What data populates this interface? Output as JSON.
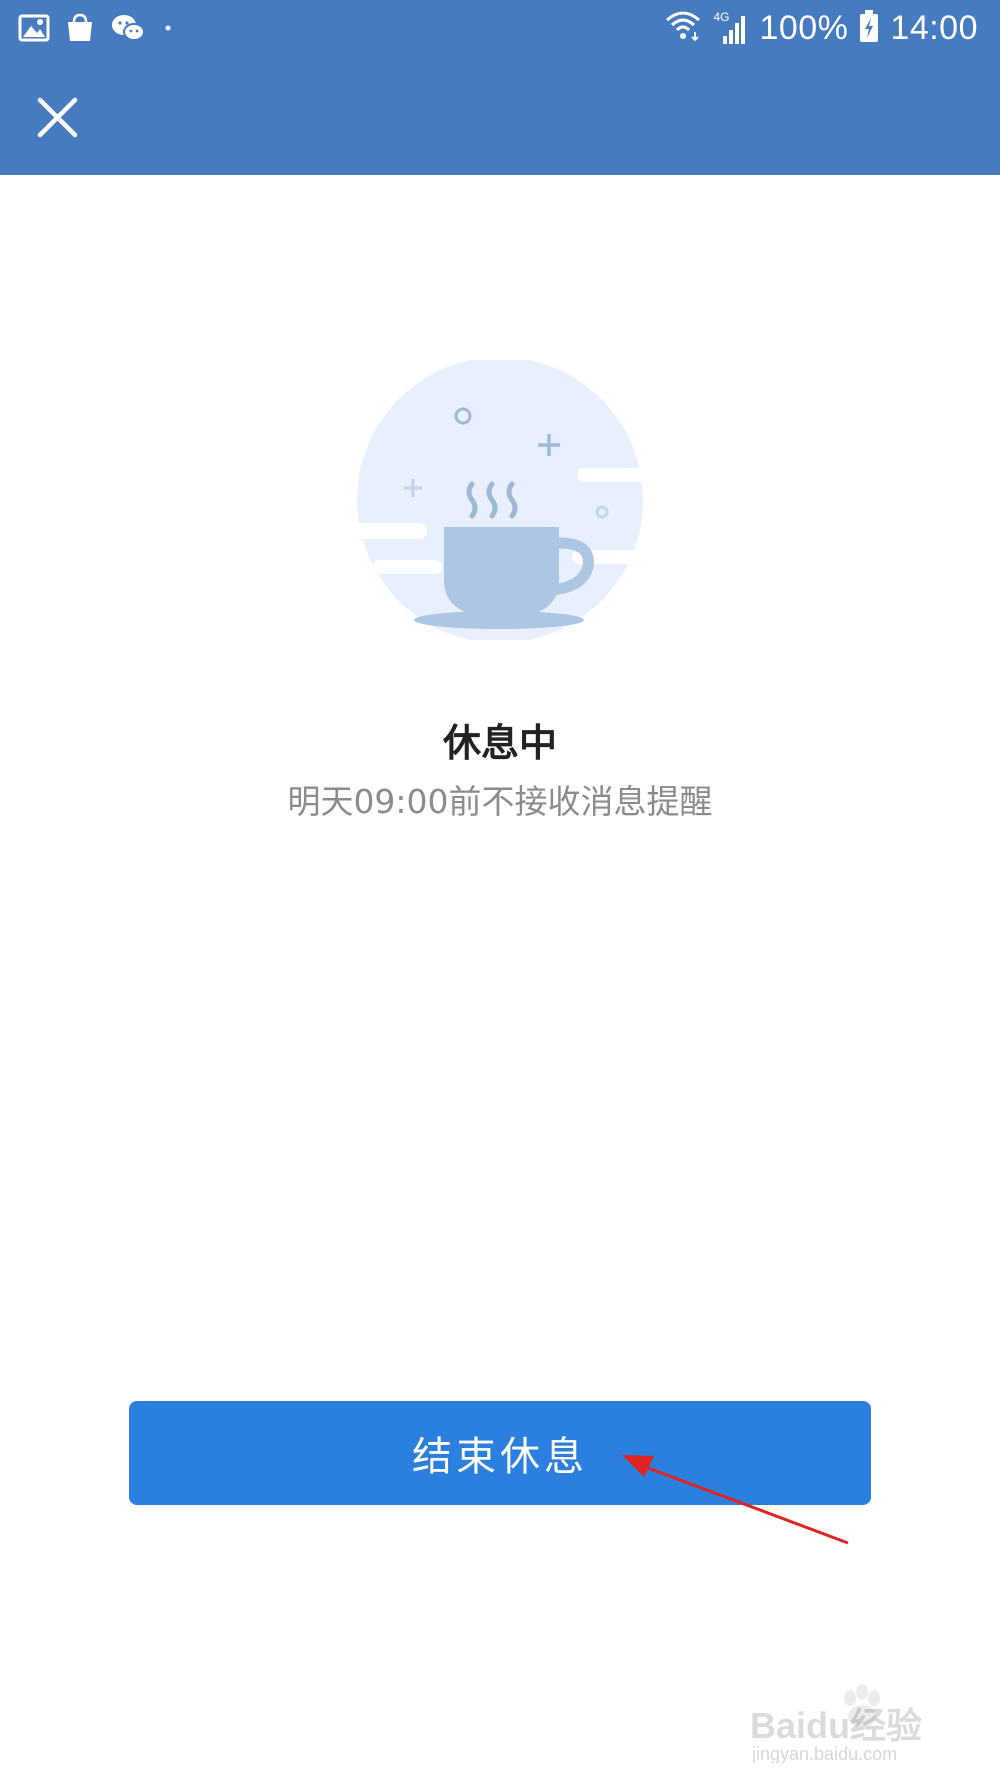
{
  "status_bar": {
    "network": "4G",
    "battery": "100%",
    "time": "14:00",
    "left_icons": [
      "image-icon",
      "shopping-bag-icon",
      "wechat-icon",
      "dot-icon"
    ],
    "right_icons": [
      "wifi-icon",
      "signal-icon",
      "battery-icon"
    ]
  },
  "header": {
    "close_icon": "close-icon",
    "background_color": "#477bbf"
  },
  "main": {
    "illustration_icon": "coffee-cup-icon",
    "title": "休息中",
    "subtitle": "明天09:00前不接收消息提醒"
  },
  "footer": {
    "end_rest_label": "结束休息",
    "button_color": "#2a7fdf"
  },
  "watermark": {
    "brand": "Baidu经验",
    "url": "jingyan.baidu.com"
  }
}
